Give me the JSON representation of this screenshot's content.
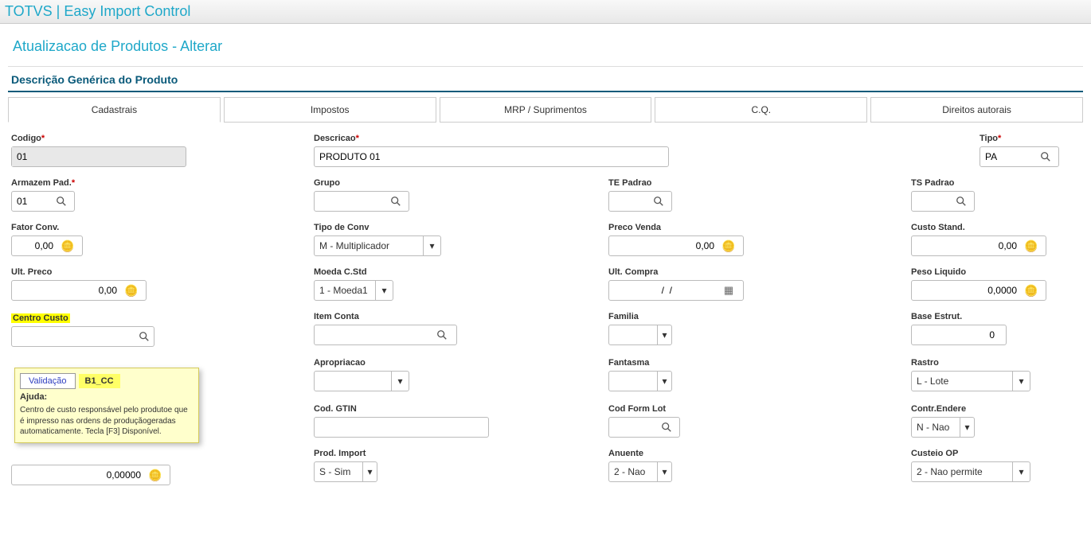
{
  "window": {
    "title": "TOTVS | Easy Import Control"
  },
  "page": {
    "title": "Atualizacao de Produtos - Alterar"
  },
  "section": {
    "title": "Descrição Genérica do Produto"
  },
  "tabs": {
    "cadastrais": "Cadastrais",
    "impostos": "Impostos",
    "mrp": "MRP / Suprimentos",
    "cq": "C.Q.",
    "direitos": "Direitos autorais"
  },
  "labels": {
    "codigo": "Codigo",
    "descricao": "Descricao",
    "tipo": "Tipo",
    "armazem": "Armazem Pad.",
    "grupo": "Grupo",
    "tepadrao": "TE Padrao",
    "tspadrao": "TS Padrao",
    "fatorconv": "Fator Conv.",
    "tipoconv": "Tipo de Conv",
    "precovenda": "Preco Venda",
    "custostand": "Custo Stand.",
    "ultpreco": "Ult. Preco",
    "moedacstd": "Moeda C.Std",
    "ultcompra": "Ult. Compra",
    "pesoliquido": "Peso Liquido",
    "centrocusto": "Centro Custo",
    "itemconta": "Item Conta",
    "familia": "Familia",
    "baseestrut": "Base Estrut.",
    "apropriacao": "Apropriacao",
    "fantasma": "Fantasma",
    "rastro": "Rastro",
    "codgtin": "Cod. GTIN",
    "codformlot": "Cod Form Lot",
    "contrendere": "Contr.Endere",
    "prodimport": "Prod. Import",
    "anuente": "Anuente",
    "custeioop": "Custeio OP"
  },
  "values": {
    "codigo": "01",
    "descricao": "PRODUTO 01",
    "tipo": "PA",
    "armazem": "01",
    "grupo": "",
    "tepadrao": "",
    "tspadrao": "",
    "fatorconv": "0,00",
    "tipoconv": "M - Multiplicador",
    "precovenda": "0,00",
    "custostand": "0,00",
    "ultpreco": "0,00",
    "moedacstd": "1 - Moeda1",
    "ultcompra": "  /  /",
    "pesoliquido": "0,0000",
    "centrocusto": "",
    "itemconta": "",
    "familia": "",
    "baseestrut": "0",
    "apropriacao": "",
    "fantasma": "",
    "rastro": "L - Lote",
    "codgtin": "",
    "codformlot": "",
    "contrendere": "N - Nao",
    "below_tooltip_num": "0,00000",
    "prodimport": "S - Sim",
    "anuente": "2 - Nao",
    "custeioop": "2 - Nao permite"
  },
  "tooltip": {
    "btn": "Validação",
    "code": "B1_CC",
    "help_label": "Ajuda:",
    "help_text": "Centro de custo responsável pelo produtoe que é impresso nas ordens de produçãogeradas automaticamente. Tecla [F3] Disponível."
  }
}
